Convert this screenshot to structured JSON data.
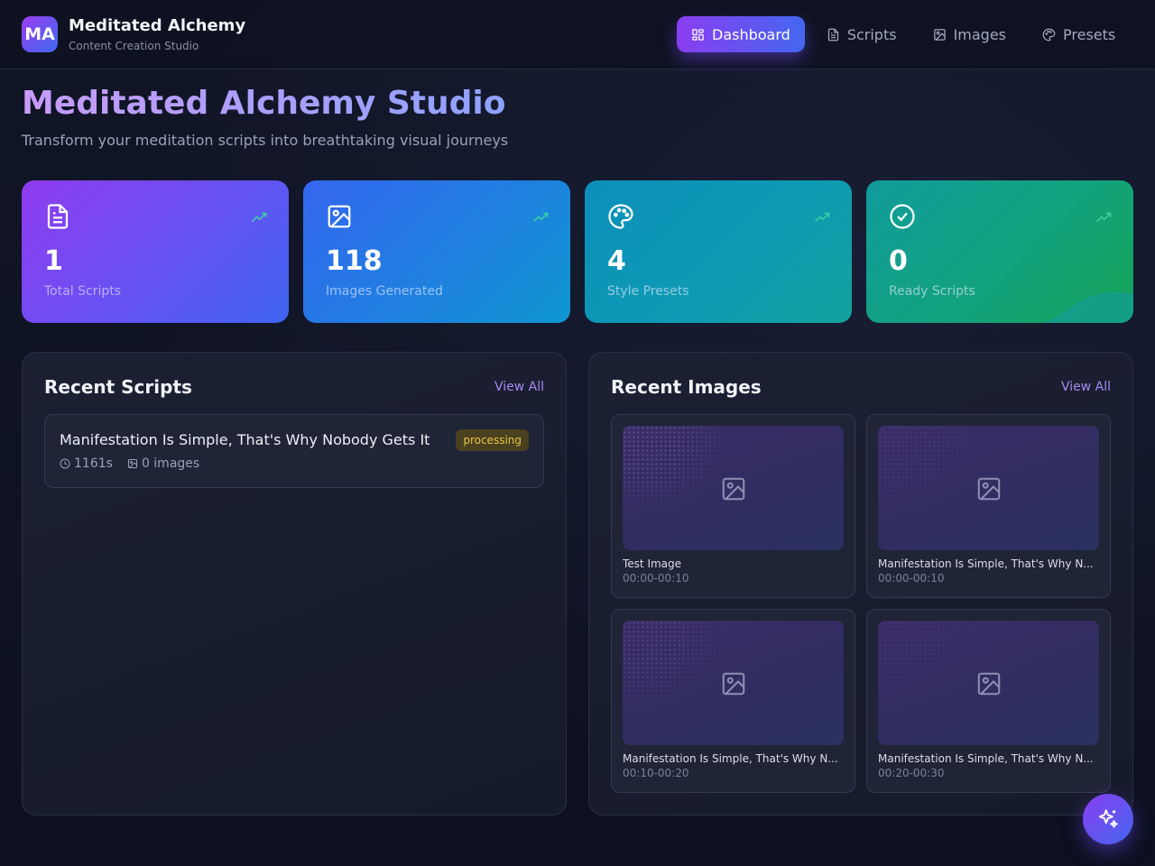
{
  "app": {
    "logo_text": "MA",
    "title": "Meditated Alchemy",
    "subtitle": "Content Creation Studio"
  },
  "nav": {
    "items": [
      {
        "label": "Dashboard",
        "icon": "dashboard-icon",
        "active": true
      },
      {
        "label": "Scripts",
        "icon": "document-icon",
        "active": false
      },
      {
        "label": "Images",
        "icon": "image-icon",
        "active": false
      },
      {
        "label": "Presets",
        "icon": "palette-icon",
        "active": false
      }
    ]
  },
  "hero": {
    "title": "Meditated Alchemy Studio",
    "subtitle": "Transform your meditation scripts into breathtaking visual journeys"
  },
  "stats": [
    {
      "value": "1",
      "label": "Total Scripts",
      "icon": "document-icon"
    },
    {
      "value": "118",
      "label": "Images Generated",
      "icon": "image-icon"
    },
    {
      "value": "4",
      "label": "Style Presets",
      "icon": "palette-icon"
    },
    {
      "value": "0",
      "label": "Ready Scripts",
      "icon": "check-circle-icon"
    }
  ],
  "recent_scripts": {
    "title": "Recent Scripts",
    "view_all": "View All",
    "items": [
      {
        "title": "Manifestation Is Simple, That's Why Nobody Gets It",
        "status": "processing",
        "duration": "1161s",
        "images": "0 images"
      }
    ]
  },
  "recent_images": {
    "title": "Recent Images",
    "view_all": "View All",
    "items": [
      {
        "title": "Test Image",
        "time": "00:00-00:10"
      },
      {
        "title": "Manifestation Is Simple, That's Why N...",
        "time": "00:00-00:10"
      },
      {
        "title": "Manifestation Is Simple, That's Why N...",
        "time": "00:10-00:20"
      },
      {
        "title": "Manifestation Is Simple, That's Why N...",
        "time": "00:20-00:30"
      }
    ]
  },
  "colors": {
    "accent_purple": "#8a3df0",
    "accent_blue": "#4467f0",
    "status_processing": "#e8c440"
  }
}
